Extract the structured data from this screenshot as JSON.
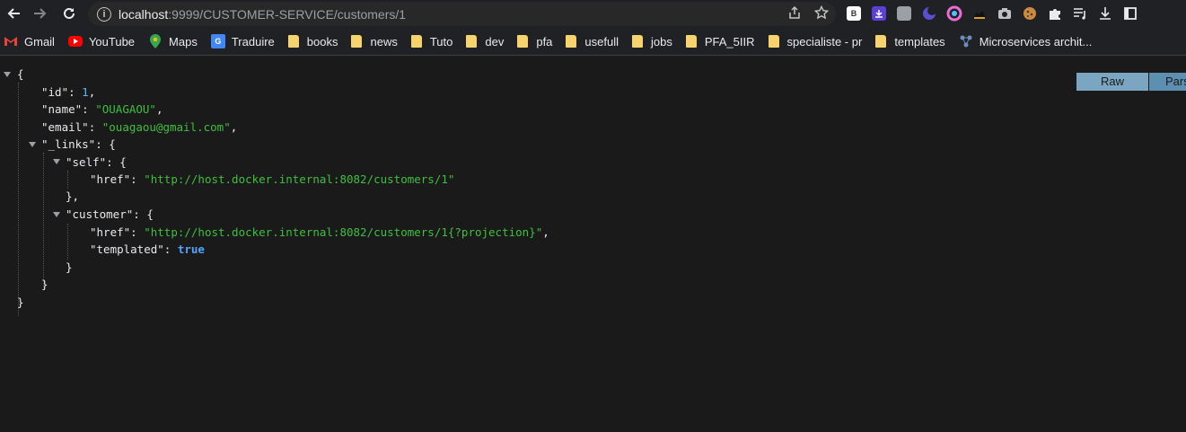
{
  "toolbar": {
    "url_host": "localhost",
    "url_rest": ":9999/CUSTOMER-SERVICE/customers/1"
  },
  "bookmarks": [
    {
      "label": "Gmail",
      "icon": "gmail-icon"
    },
    {
      "label": "YouTube",
      "icon": "youtube-icon"
    },
    {
      "label": "Maps",
      "icon": "maps-icon"
    },
    {
      "label": "Traduire",
      "icon": "translate-icon"
    },
    {
      "label": "books",
      "icon": "folder-icon"
    },
    {
      "label": "news",
      "icon": "folder-icon"
    },
    {
      "label": "Tuto",
      "icon": "folder-icon"
    },
    {
      "label": "dev",
      "icon": "folder-icon"
    },
    {
      "label": "pfa",
      "icon": "folder-icon"
    },
    {
      "label": "usefull",
      "icon": "folder-icon"
    },
    {
      "label": "jobs",
      "icon": "folder-icon"
    },
    {
      "label": "PFA_5IIR",
      "icon": "folder-icon"
    },
    {
      "label": "specialiste - pr",
      "icon": "folder-icon"
    },
    {
      "label": "templates",
      "icon": "folder-icon"
    },
    {
      "label": "Microservices archit...",
      "icon": "microservices-icon"
    }
  ],
  "json": {
    "id_key": "\"id\"",
    "id_val": "1",
    "name_key": "\"name\"",
    "name_val": "\"OUAGAOU\"",
    "email_key": "\"email\"",
    "email_val": "\"ouagaou@gmail.com\"",
    "links_key": "\"_links\"",
    "self_key": "\"self\"",
    "href_key": "\"href\"",
    "self_href": "\"http://host.docker.internal:8082/customers/1\"",
    "customer_key": "\"customer\"",
    "customer_href": "\"http://host.docker.internal:8082/customers/1{?projection}\"",
    "templated_key": "\"templated\"",
    "templated_val": "true"
  },
  "viewer": {
    "raw_label": "Raw",
    "parsed_label": "Pars"
  }
}
